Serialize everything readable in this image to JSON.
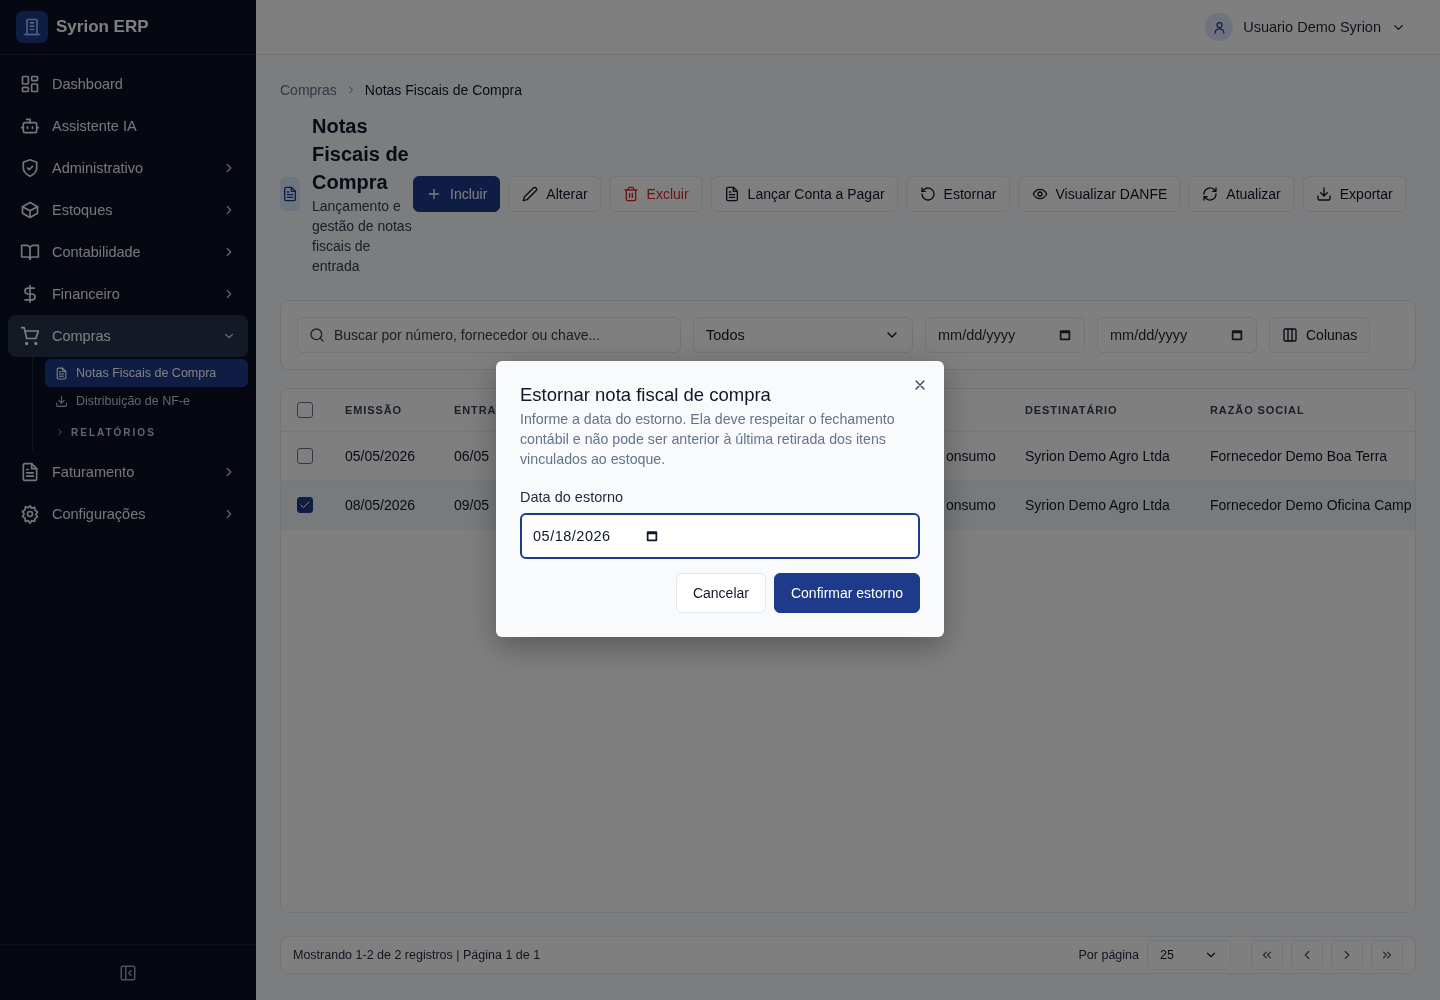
{
  "app": {
    "name": "Syrion ERP"
  },
  "sidebar": {
    "items": [
      {
        "label": "Dashboard",
        "selected": false
      },
      {
        "label": "Assistente IA",
        "selected": false
      },
      {
        "label": "Administrativo",
        "selected": false,
        "expanded": false
      },
      {
        "label": "Estoques",
        "selected": false,
        "expanded": false
      },
      {
        "label": "Contabilidade",
        "selected": false,
        "expanded": false
      },
      {
        "label": "Financeiro",
        "selected": false,
        "expanded": false
      },
      {
        "label": "Compras",
        "selected": true,
        "expanded": true,
        "children": [
          {
            "kind": "link",
            "label": "Notas Fiscais de Compra",
            "selected": true
          },
          {
            "kind": "link",
            "label": "Distribuição de NF-e",
            "selected": false
          },
          {
            "kind": "group",
            "label": "RELATÓRIOS",
            "expanded": false
          }
        ]
      },
      {
        "label": "Faturamento",
        "selected": false,
        "expanded": false
      },
      {
        "label": "Configurações",
        "selected": false,
        "expanded": false
      }
    ]
  },
  "user": {
    "name": "Usuario Demo Syrion"
  },
  "breadcrumb": [
    "Compras",
    "Notas Fiscais de Compra"
  ],
  "page": {
    "title": "Notas Fiscais de Compra",
    "subtitle": "Lançamento e gestão de notas fiscais de entrada"
  },
  "toolbar": [
    {
      "label": "Incluir",
      "kind": "primary"
    },
    {
      "label": "Alterar",
      "kind": "default"
    },
    {
      "label": "Excluir",
      "kind": "danger"
    },
    {
      "label": "Lançar Conta a Pagar",
      "kind": "default"
    },
    {
      "label": "Estornar",
      "kind": "default"
    },
    {
      "label": "Visualizar DANFE",
      "kind": "default"
    },
    {
      "label": "Atualizar",
      "kind": "default"
    },
    {
      "label": "Exportar",
      "kind": "default"
    }
  ],
  "filters": {
    "search": {
      "placeholder": "Buscar por número, fornecedor ou chave..."
    },
    "status": "Todos",
    "date_from": {
      "placeholder": "mm/dd/yyyy"
    },
    "date_to": {
      "placeholder": "mm/dd/yyyy"
    },
    "columns_button": "Colunas"
  },
  "table": {
    "header": {
      "checked": false,
      "emissao": "EMISSÃO",
      "entrada": "ENTRA",
      "destinatario": "DESTINATÁRIO",
      "razao_social": "RAZÃO SOCIAL"
    },
    "rows": [
      {
        "checked": false,
        "emissao": "05/05/2026",
        "entrada": "06/05",
        "column_4": "onsumo",
        "destinatario": "Syrion Demo Agro Ltda",
        "razao_social": "Fornecedor Demo Boa Terra"
      },
      {
        "checked": true,
        "emissao": "08/05/2026",
        "entrada": "09/05",
        "column_4": "onsumo",
        "destinatario": "Syrion Demo Agro Ltda",
        "razao_social": "Fornecedor Demo Oficina Camp"
      }
    ]
  },
  "pagination": {
    "summary": "Mostrando 1-2 de 2 registros | Página 1 de 1",
    "per_page_label": "Por página",
    "per_page": "25"
  },
  "dialog": {
    "title": "Estornar nota fiscal de compra",
    "description": "Informe a data do estorno. Ela deve respeitar o fechamento contábil e não pode ser anterior à última retirada dos itens vinculados ao estoque.",
    "field_label": "Data do estorno",
    "field_value": "05/18/2026",
    "focused": true,
    "buttons": [
      {
        "label": "Cancelar",
        "kind": "default"
      },
      {
        "label": "Confirmar estorno",
        "kind": "primary"
      }
    ]
  }
}
